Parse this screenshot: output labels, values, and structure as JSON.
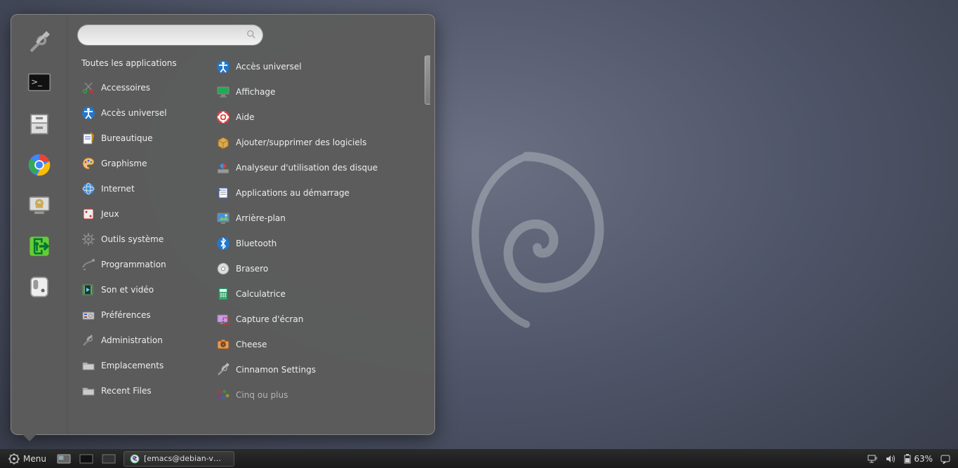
{
  "menu": {
    "search_placeholder": "",
    "categories_header": "Toutes les applications",
    "sidebar": [
      {
        "id": "settings",
        "icon": "tools-icon"
      },
      {
        "id": "terminal",
        "icon": "terminal-icon"
      },
      {
        "id": "files",
        "icon": "file-cabinet-icon"
      },
      {
        "id": "chrome",
        "icon": "chrome-icon"
      },
      {
        "id": "lock",
        "icon": "lock-screen-icon"
      },
      {
        "id": "logout",
        "icon": "exit-icon"
      },
      {
        "id": "shutdown",
        "icon": "power-icon"
      }
    ],
    "categories": [
      {
        "label": "Accessoires",
        "icon": "scissors-icon"
      },
      {
        "label": "Accès universel",
        "icon": "accessibility-icon"
      },
      {
        "label": "Bureautique",
        "icon": "office-icon"
      },
      {
        "label": "Graphisme",
        "icon": "palette-icon"
      },
      {
        "label": "Internet",
        "icon": "globe-icon"
      },
      {
        "label": "Jeux",
        "icon": "dice-icon"
      },
      {
        "label": "Outils système",
        "icon": "gear-icon"
      },
      {
        "label": "Programmation",
        "icon": "code-icon"
      },
      {
        "label": "Son et vidéo",
        "icon": "media-icon"
      },
      {
        "label": "Préférences",
        "icon": "preferences-icon"
      },
      {
        "label": "Administration",
        "icon": "admin-icon"
      },
      {
        "label": "Emplacements",
        "icon": "folder-icon"
      },
      {
        "label": "Recent Files",
        "icon": "folder-icon"
      }
    ],
    "apps": [
      {
        "label": "Accès universel",
        "icon": "accessibility-icon"
      },
      {
        "label": "Affichage",
        "icon": "display-icon"
      },
      {
        "label": "Aide",
        "icon": "help-icon"
      },
      {
        "label": "Ajouter/supprimer des logiciels",
        "icon": "package-icon"
      },
      {
        "label": "Analyseur d'utilisation des disque",
        "icon": "disk-usage-icon"
      },
      {
        "label": "Applications au démarrage",
        "icon": "startup-icon"
      },
      {
        "label": "Arrière-plan",
        "icon": "wallpaper-icon"
      },
      {
        "label": "Bluetooth",
        "icon": "bluetooth-icon"
      },
      {
        "label": "Brasero",
        "icon": "disc-icon"
      },
      {
        "label": "Calculatrice",
        "icon": "calculator-icon"
      },
      {
        "label": "Capture d'écran",
        "icon": "screenshot-icon"
      },
      {
        "label": "Cheese",
        "icon": "cheese-icon"
      },
      {
        "label": "Cinnamon Settings",
        "icon": "tools-icon"
      },
      {
        "label": "Cinq ou plus",
        "icon": "five-balls-icon",
        "dim": true
      }
    ]
  },
  "taskbar": {
    "menu_label": "Menu",
    "window_title": "[emacs@debian-vm...",
    "battery": "63%"
  }
}
